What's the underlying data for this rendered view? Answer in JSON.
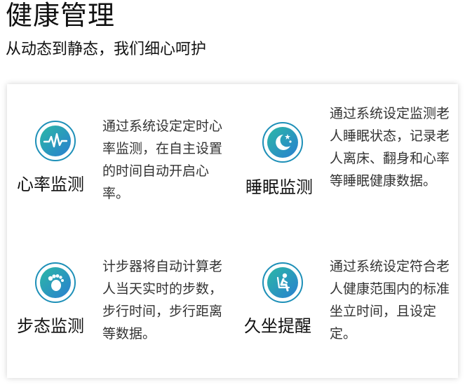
{
  "header": {
    "title": "健康管理",
    "subtitle": "从动态到静态，我们细心呵护"
  },
  "features": [
    {
      "icon": "heartbeat-icon",
      "title": "心率监测",
      "desc": "通过系统设定定时心率监测，在自主设置的时间自动开启心率。"
    },
    {
      "icon": "moon-stars-icon",
      "title": "睡眠监测",
      "desc": "通过系统设定监测老人睡眠状态，记录老人离床、翻身和心率等睡眠健康数据。"
    },
    {
      "icon": "footprint-icon",
      "title": "步态监测",
      "desc": "计步器将自动计算老人当天实时的步数，步行时间，步行距离等数据。"
    },
    {
      "icon": "seated-person-icon",
      "title": "久坐提醒",
      "desc": "通过系统设定符合老人健康范围内的标准坐立时间，且设定定。"
    }
  ],
  "colors": {
    "icon_ring": "#1e90b8",
    "icon_gradient_start": "#2bb8a6",
    "icon_gradient_end": "#2a7fd0"
  }
}
